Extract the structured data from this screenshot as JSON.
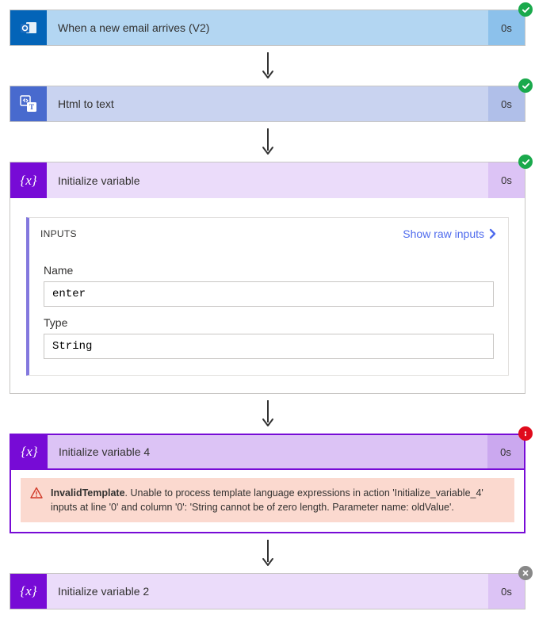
{
  "steps": {
    "trigger": {
      "title": "When a new email arrives (V2)",
      "duration": "0s",
      "status": "success"
    },
    "html2text": {
      "title": "Html to text",
      "duration": "0s",
      "status": "success"
    },
    "initvar": {
      "title": "Initialize variable",
      "duration": "0s",
      "status": "success"
    },
    "initvar4": {
      "title": "Initialize variable 4",
      "duration": "0s",
      "status": "error"
    },
    "initvar2": {
      "title": "Initialize variable 2",
      "duration": "0s",
      "status": "skipped"
    }
  },
  "initvar_inputs": {
    "panel_title": "INPUTS",
    "show_raw_label": "Show raw inputs",
    "name_label": "Name",
    "name_value": "enter",
    "type_label": "Type",
    "type_value": "String"
  },
  "initvar4_error": {
    "title": "InvalidTemplate",
    "message": ". Unable to process template language expressions in action 'Initialize_variable_4' inputs at line '0' and column '0': 'String cannot be of zero length. Parameter name: oldValue'."
  }
}
